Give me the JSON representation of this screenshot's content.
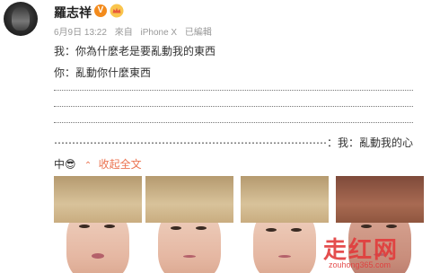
{
  "post": {
    "author": "羅志祥",
    "verified_badge": "V",
    "date": "6月9日 13:22",
    "source_prefix": "來自",
    "device": "iPhone X",
    "edited": "已編輯",
    "lines": [
      "我：你為什麼老是要亂動我的東西",
      "你：亂動你什麼東西"
    ],
    "final_line": "⋯⋯⋯⋯⋯⋯⋯⋯⋯⋯⋯⋯⋯⋯⋯⋯⋯⋯⋯⋯⋯⋯⋯⋯⋯⋯⋯⋯⋯⋯⋯⋯⋯⋯⋯⋯⋯⋯⋯⋯⋯⋯⋯⋯⋯⋯⋯⋯⋯⋯⋯⋯⋯⋯⋯⋯⋯⋯⋯⋯⋯⋯⋯⋯⋯⋯⋯⋯⋯⋯⋯⋯⋯⋯⋯⋯⋯⋯⋯⋯⋯⋯⋯⋯⋯⋯⋯⋯⋯⋯⋯⋯⋯⋯⋯⋯：我：亂動我的心",
    "symbols": "中😎",
    "collapse_label": "收起全文",
    "collapse_arrow": "⌃",
    "photos_count": 4
  },
  "watermark": {
    "text": "走红网",
    "url": "zouhong365.com"
  },
  "colors": {
    "accent": "#eb7350",
    "badge": "#f38b1c",
    "watermark": "#e23b3b"
  },
  "icons": {
    "verified": "verified-badge-icon",
    "crown": "vip-crown-icon",
    "collapse": "chevron-up-icon"
  }
}
